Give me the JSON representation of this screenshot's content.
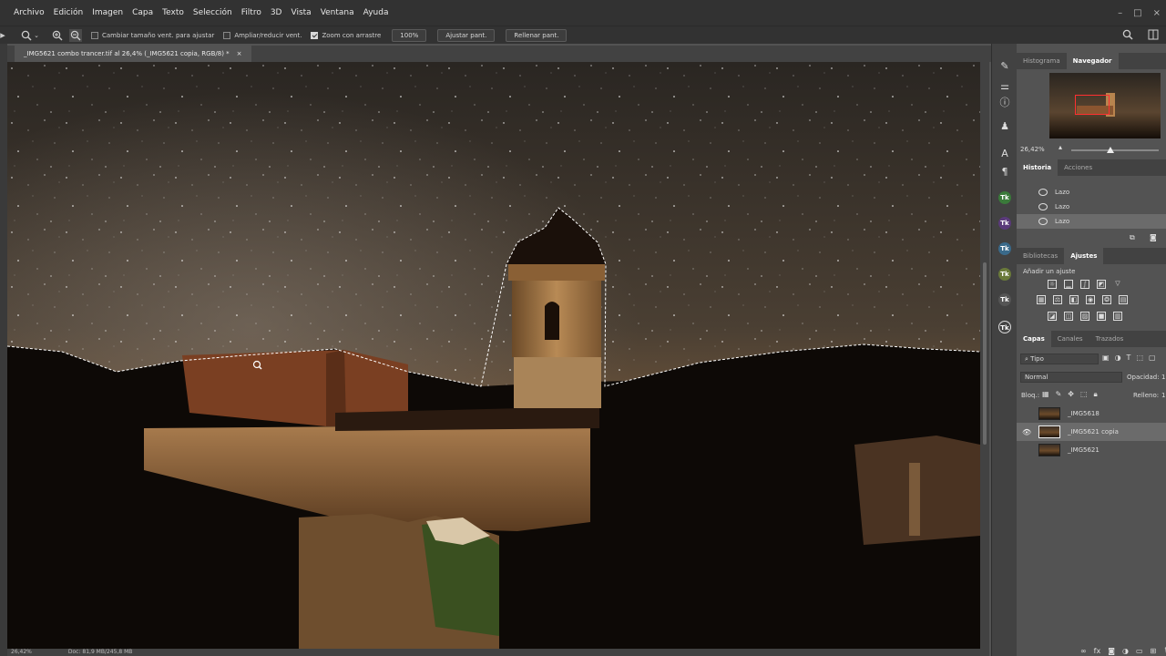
{
  "menubar": {
    "items": [
      "Archivo",
      "Edición",
      "Imagen",
      "Capa",
      "Texto",
      "Selección",
      "Filtro",
      "3D",
      "Vista",
      "Ventana",
      "Ayuda"
    ],
    "window_controls": [
      "–",
      "□",
      "×"
    ]
  },
  "options_bar": {
    "tool_icon": "zoom-tool-icon",
    "resize_windows_label": "Cambiar tamaño vent. para ajustar",
    "resize_windows_checked": false,
    "zoom_all_windows_label": "Ampliar/reducir vent.",
    "zoom_all_windows_checked": false,
    "scrubby_zoom_label": "Zoom con arrastre",
    "scrubby_zoom_checked": true,
    "zoom_100_label": "100%",
    "fit_screen_label": "Ajustar pant.",
    "fill_screen_label": "Rellenar pant."
  },
  "document": {
    "tab_title": "_IMG5621 combo trancer.tif al 26,4% (_IMG5621 copia, RGB/8) *",
    "tab_close": "×"
  },
  "statusbar": {
    "zoom": "26,42%",
    "doc_size": "Doc: 81,9 MB/245,8 MB"
  },
  "navigator": {
    "tabs": [
      "Histograma",
      "Navegador"
    ],
    "active_tab": "Navegador",
    "zoom_value": "26,42%",
    "zoom_level": 0.45
  },
  "history": {
    "tabs": [
      "Historia",
      "Acciones"
    ],
    "active_tab": "Historia",
    "items": [
      "Lazo",
      "Lazo",
      "Lazo"
    ],
    "selected_index": 2
  },
  "adjustments": {
    "tabs": [
      "Bibliotecas",
      "Ajustes"
    ],
    "active_tab": "Ajustes",
    "heading": "Añadir un ajuste"
  },
  "layers": {
    "tabs": [
      "Capas",
      "Canales",
      "Trazados"
    ],
    "active_tab": "Capas",
    "filter_label": "Tipo",
    "blend_mode": "Normal",
    "opacity_label": "Opacidad:",
    "opacity_value": "1",
    "lock_label": "Bloq.:",
    "fill_label": "Relleno:",
    "fill_value": "1",
    "items": [
      {
        "name": "_IMG5618",
        "visible": false,
        "selected": false
      },
      {
        "name": "_IMG5621 copia",
        "visible": true,
        "selected": true
      },
      {
        "name": "_IMG5621",
        "visible": false,
        "selected": false
      }
    ]
  },
  "colors": {
    "chrome_dark": "#323232",
    "panel": "#535353",
    "selection": "#6b6b6b",
    "navigator_view_box": "#ff3030"
  }
}
